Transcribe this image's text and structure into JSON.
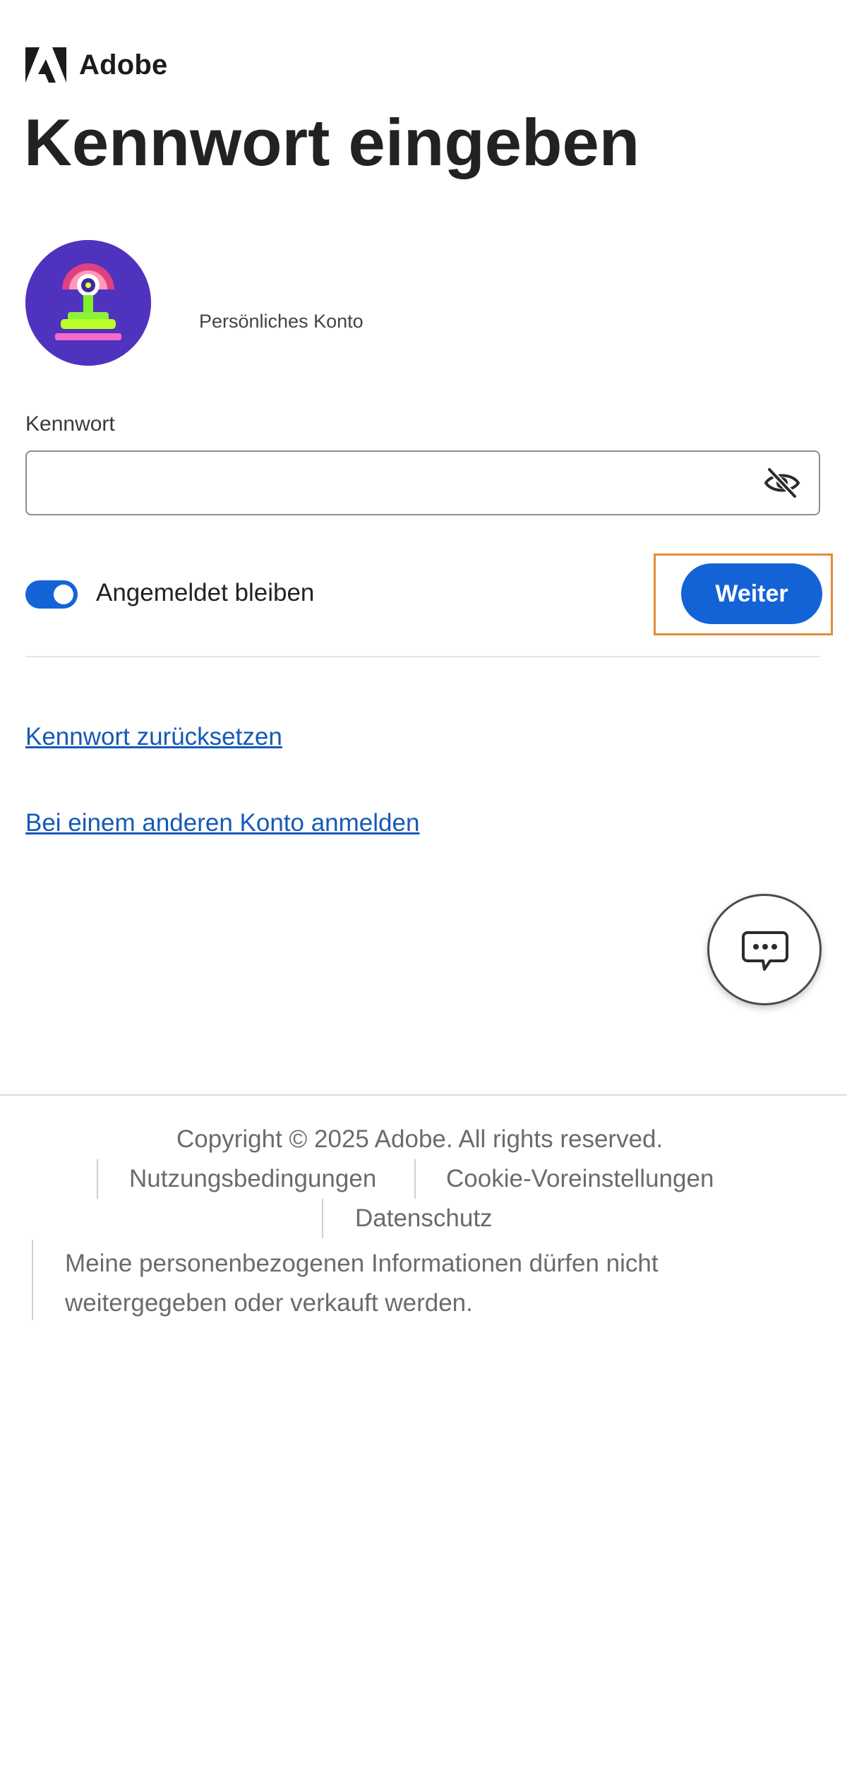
{
  "header": {
    "brand_name": "Adobe",
    "logo_icon": "adobe-logo-icon"
  },
  "page_title": "Kennwort eingeben",
  "account": {
    "avatar_icon": "avatar-image",
    "type_label": "Persönliches Konto"
  },
  "password": {
    "label": "Kennwort",
    "value": "",
    "placeholder": "",
    "visibility_icon": "eye-slash-icon"
  },
  "stay_signed_in": {
    "label": "Angemeldet bleiben",
    "checked": true
  },
  "continue_button": {
    "label": "Weiter"
  },
  "links": {
    "reset_password": "Kennwort zurücksetzen",
    "other_account": "Bei einem anderen Konto anmelden"
  },
  "chat": {
    "icon": "chat-bubble-icon"
  },
  "footer": {
    "copyright": "Copyright © 2025 Adobe. All rights reserved.",
    "terms": "Nutzungsbedingungen",
    "cookies": "Cookie-Voreinstellungen",
    "privacy": "Datenschutz",
    "do_not_sell": "Meine personenbezogenen Informationen dürfen nicht weitergegeben oder verkauft werden."
  },
  "colors": {
    "accent": "#1463d6",
    "link": "#1659b8",
    "highlight": "#e38a3a",
    "avatar_bg": "#4f33bf"
  }
}
